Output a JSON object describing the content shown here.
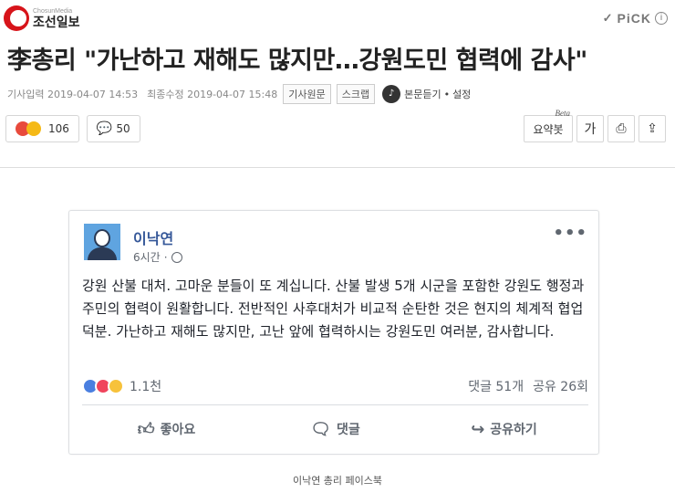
{
  "header": {
    "logo_small": "ChosunMedia",
    "logo_big": "조선일보",
    "pick_label": "PiCK",
    "info_icon": "i"
  },
  "article": {
    "headline": "李총리 \"가난하고 재해도 많지만…강원도민 협력에 감사\"",
    "published": "기사입력 2019-04-07 14:53",
    "modified": "최종수정 2019-04-07 15:48",
    "tag_original": "기사원문",
    "tag_scrap": "스크랩",
    "listen_label": "본문듣기",
    "listen_sep": "•",
    "settings_label": "설정",
    "reaction_count": "106",
    "comment_count": "50",
    "summary_label": "요약봇",
    "beta_label": "Beta",
    "font_label": "가",
    "colors": {
      "brand": "#d7141a",
      "fb_name": "#365899"
    }
  },
  "fb_post": {
    "author": "이낙연",
    "time": "6시간",
    "dot": "·",
    "body": "강원 산불 대처. 고마운 분들이 또 계십니다. 산불 발생 5개 시군을 포함한 강원도 행정과 주민의 협력이 원활합니다. 전반적인 사후대처가 비교적 순탄한 것은 현지의 체계적 협업 덕분. 가난하고 재해도 많지만, 고난 앞에 협력하시는 강원도민 여러분, 감사합니다.",
    "reactions": "1.1천",
    "comments": "댓글 51개",
    "shares": "공유 26회",
    "like_label": "좋아요",
    "comment_label": "댓글",
    "share_label": "공유하기"
  },
  "caption": "이낙연 총리 페이스북"
}
